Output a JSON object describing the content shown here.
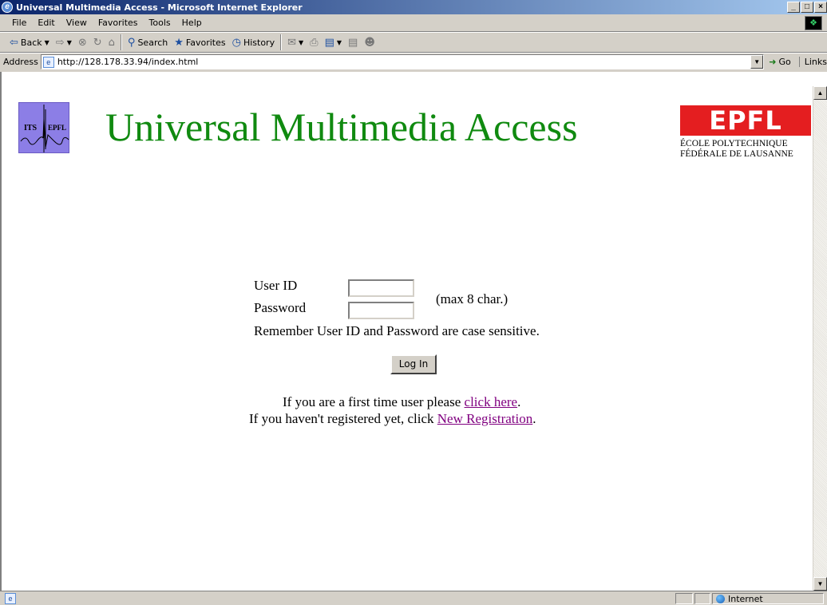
{
  "window": {
    "title": "Universal Multimedia Access - Microsoft Internet Explorer",
    "controls": [
      "_",
      "А",
      "×"
    ]
  },
  "menu": [
    "File",
    "Edit",
    "View",
    "Favorites",
    "Tools",
    "Help"
  ],
  "toolbar": {
    "back": "Back",
    "search": "Search",
    "favorites": "Favorites",
    "history": "History"
  },
  "address": {
    "label": "Address",
    "url": "http://128.178.33.94/index.html",
    "go": "Go",
    "links": "Links"
  },
  "page": {
    "title": "Universal Multimedia Access",
    "its_logo": {
      "left": "ITS",
      "right": "EPFL"
    },
    "epfl_logo": {
      "mark": "EPFL",
      "line1": "ÉCOLE POLYTECHNIQUE",
      "line2": "FÉDÉRALE DE LAUSANNE"
    },
    "form": {
      "user_id_label": "User ID",
      "password_label": "Password",
      "max_hint": "(max 8 char.)",
      "case_note": "Remember User ID and Password are case sensitive.",
      "login_button": "Log In",
      "user_id_value": "",
      "password_value": ""
    },
    "first_time": {
      "prefix": "If you are a first time user please ",
      "link": "click here",
      "suffix": "."
    },
    "registration": {
      "prefix": "If you haven't registered yet, click ",
      "link": "New Registration",
      "suffix": "."
    }
  },
  "status": {
    "zone": "Internet"
  }
}
